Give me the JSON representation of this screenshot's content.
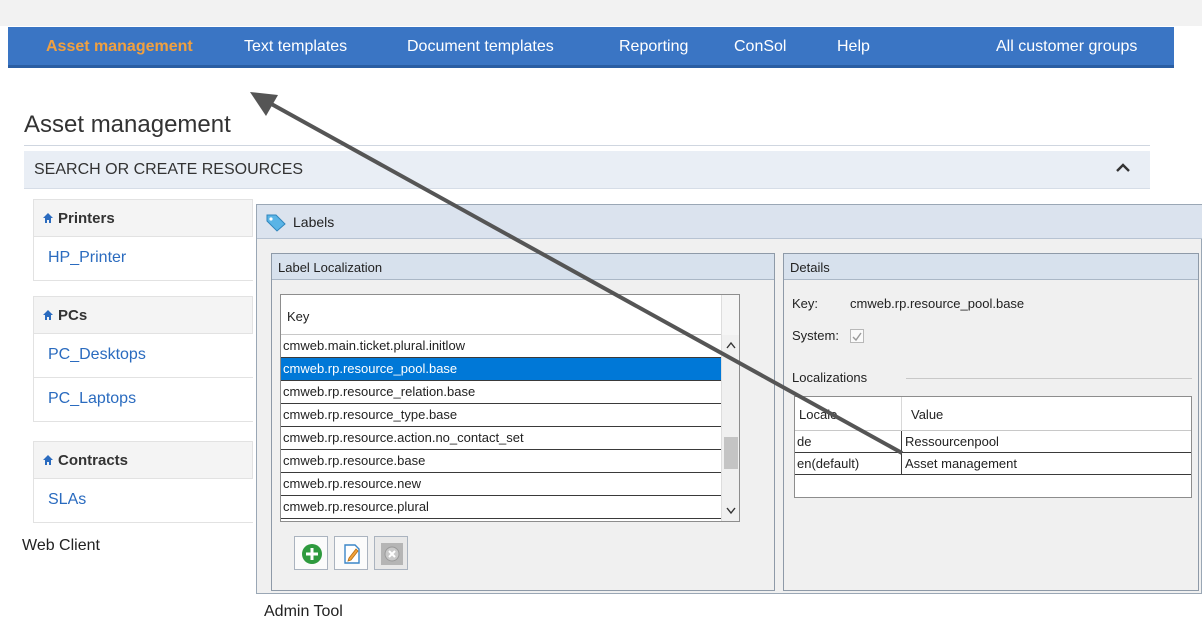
{
  "web_client": {
    "nav": {
      "items": [
        {
          "label": "Asset management",
          "active": true
        },
        {
          "label": "Text templates"
        },
        {
          "label": "Document templates"
        },
        {
          "label": "Reporting"
        },
        {
          "label": "ConSol"
        },
        {
          "label": "Help"
        }
      ],
      "right_label": "All customer groups"
    },
    "page_title": "Asset management",
    "section_title": "SEARCH OR CREATE RESOURCES",
    "categories": [
      {
        "title": "Printers",
        "items": [
          "HP_Printer"
        ]
      },
      {
        "title": "PCs",
        "items": [
          "PC_Desktops",
          "PC_Laptops"
        ]
      },
      {
        "title": "Contracts",
        "items": [
          "SLAs"
        ]
      }
    ],
    "caption": "Web Client"
  },
  "admin_tool": {
    "window_title": "Labels",
    "left_panel_title": "Label Localization",
    "key_column": "Key",
    "keys": [
      "cmweb.main.ticket.plural.initlow",
      "cmweb.rp.resource_pool.base",
      "cmweb.rp.resource_relation.base",
      "cmweb.rp.resource_type.base",
      "cmweb.rp.resource.action.no_contact_set",
      "cmweb.rp.resource.base",
      "cmweb.rp.resource.new",
      "cmweb.rp.resource.plural"
    ],
    "selected_key_index": 1,
    "details": {
      "title": "Details",
      "key_label": "Key:",
      "key_value": "cmweb.rp.resource_pool.base",
      "system_label": "System:",
      "system_checked": true,
      "localizations_label": "Localizations",
      "locale_header": "Locale",
      "value_header": "Value",
      "rows": [
        {
          "locale": "de",
          "value": "Ressourcenpool"
        },
        {
          "locale": "en(default)",
          "value": "Asset management"
        }
      ]
    },
    "buttons": [
      "add-icon",
      "edit-icon",
      "delete-icon"
    ],
    "caption": "Admin Tool"
  },
  "colors": {
    "nav_bg": "#3a75c4",
    "nav_active": "#f0a040",
    "link": "#2a6bbf",
    "selection": "#0078d7",
    "arrow": "#555555"
  }
}
